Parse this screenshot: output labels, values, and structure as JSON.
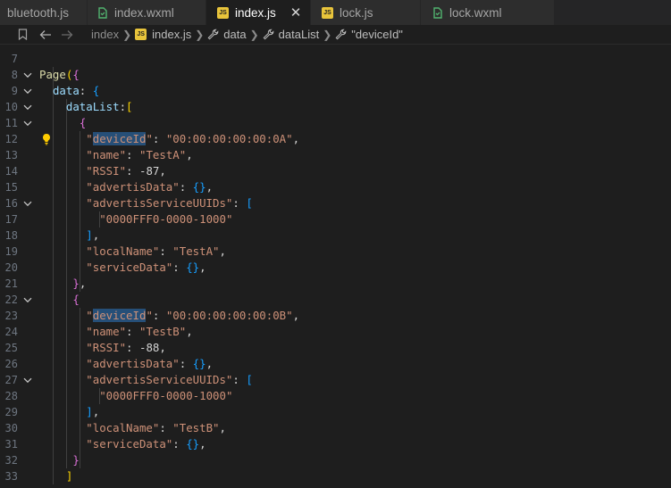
{
  "tabs": [
    {
      "label": "bluetooth.js",
      "icon": "js-file-icon",
      "active": false
    },
    {
      "label": "index.wxml",
      "icon": "wxml-file-icon",
      "active": false
    },
    {
      "label": "index.js",
      "icon": "js-file-icon",
      "active": true
    },
    {
      "label": "lock.js",
      "icon": "js-file-icon",
      "active": false
    },
    {
      "label": "lock.wxml",
      "icon": "wxml-file-icon",
      "active": false
    }
  ],
  "tab_close_glyph": "✕",
  "breadcrumb": {
    "items": [
      "index",
      "index.js",
      "data",
      "dataList",
      "\"deviceId\""
    ],
    "js_badge": "JS"
  },
  "colors": {
    "background": "#1e1e1e",
    "string": "#ce9178",
    "function": "#dcdcaa",
    "property": "#9cdcfe",
    "bracket_gold": "#ffd700",
    "bracket_purple": "#da70d6",
    "bracket_blue": "#179fff"
  },
  "editor": {
    "lines": [
      {
        "n": "7",
        "text": ""
      },
      {
        "n": "8",
        "text": "Page({"
      },
      {
        "n": "9",
        "text": "  data: {"
      },
      {
        "n": "10",
        "text": "    dataList:["
      },
      {
        "n": "11",
        "text": "      {"
      },
      {
        "n": "12",
        "text": "       \"deviceId\": \"00:00:00:00:00:0A\","
      },
      {
        "n": "13",
        "text": "       \"name\": \"TestA\","
      },
      {
        "n": "14",
        "text": "       \"RSSI\": -87,"
      },
      {
        "n": "15",
        "text": "       \"advertisData\": {},"
      },
      {
        "n": "16",
        "text": "       \"advertisServiceUUIDs\": ["
      },
      {
        "n": "17",
        "text": "         \"0000FFF0-0000-1000\""
      },
      {
        "n": "18",
        "text": "       ],"
      },
      {
        "n": "19",
        "text": "       \"localName\": \"TestA\","
      },
      {
        "n": "20",
        "text": "       \"serviceData\": {},"
      },
      {
        "n": "21",
        "text": "     },"
      },
      {
        "n": "22",
        "text": "     {"
      },
      {
        "n": "23",
        "text": "       \"deviceId\": \"00:00:00:00:00:0B\","
      },
      {
        "n": "24",
        "text": "       \"name\": \"TestB\","
      },
      {
        "n": "25",
        "text": "       \"RSSI\": -88,"
      },
      {
        "n": "26",
        "text": "       \"advertisData\": {},"
      },
      {
        "n": "27",
        "text": "       \"advertisServiceUUIDs\": ["
      },
      {
        "n": "28",
        "text": "         \"0000FFF0-0000-1000\""
      },
      {
        "n": "29",
        "text": "       ],"
      },
      {
        "n": "30",
        "text": "       \"localName\": \"TestB\","
      },
      {
        "n": "31",
        "text": "       \"serviceData\": {},"
      },
      {
        "n": "32",
        "text": "     }"
      },
      {
        "n": "33",
        "text": "    ]"
      }
    ]
  }
}
